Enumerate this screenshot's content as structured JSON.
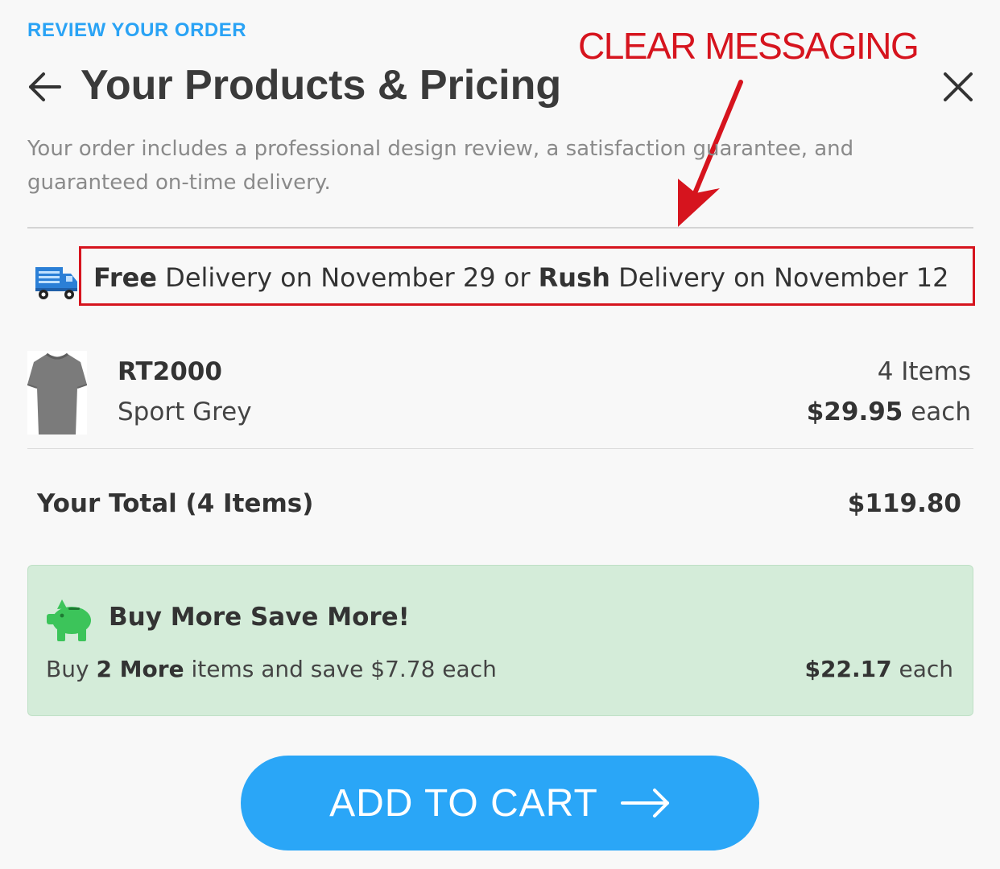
{
  "header": {
    "eyebrow": "REVIEW YOUR ORDER",
    "title": "Your Products & Pricing",
    "back_icon": "arrow-left-icon",
    "close_icon": "close-icon"
  },
  "annotation": {
    "label": "CLEAR MESSAGING",
    "color": "#d6141e"
  },
  "subtitle": "Your order includes a professional design review, a satisfaction guarantee, and guaranteed on-time delivery.",
  "delivery": {
    "icon": "delivery-truck-icon",
    "free_word": "Free",
    "free_text": " Delivery on November 29 or ",
    "rush_word": "Rush",
    "rush_text": " Delivery on November 12"
  },
  "product": {
    "image": "grey-tshirt-thumbnail",
    "code": "RT2000",
    "color": "Sport Grey",
    "quantity": "4 Items",
    "price": "$29.95",
    "price_suffix": " each"
  },
  "total": {
    "label": "Your Total (4 Items)",
    "value": "$119.80"
  },
  "promo": {
    "icon": "piggy-bank-icon",
    "title": "Buy More Save More!",
    "text_prefix": "Buy ",
    "text_bold": "2 More",
    "text_suffix": " items and save $7.78 each",
    "price": "$22.17",
    "price_suffix": " each",
    "background": "#d4ecd9"
  },
  "cta": {
    "label": "ADD TO CART",
    "icon": "arrow-right-icon",
    "color": "#2aa6f7"
  }
}
